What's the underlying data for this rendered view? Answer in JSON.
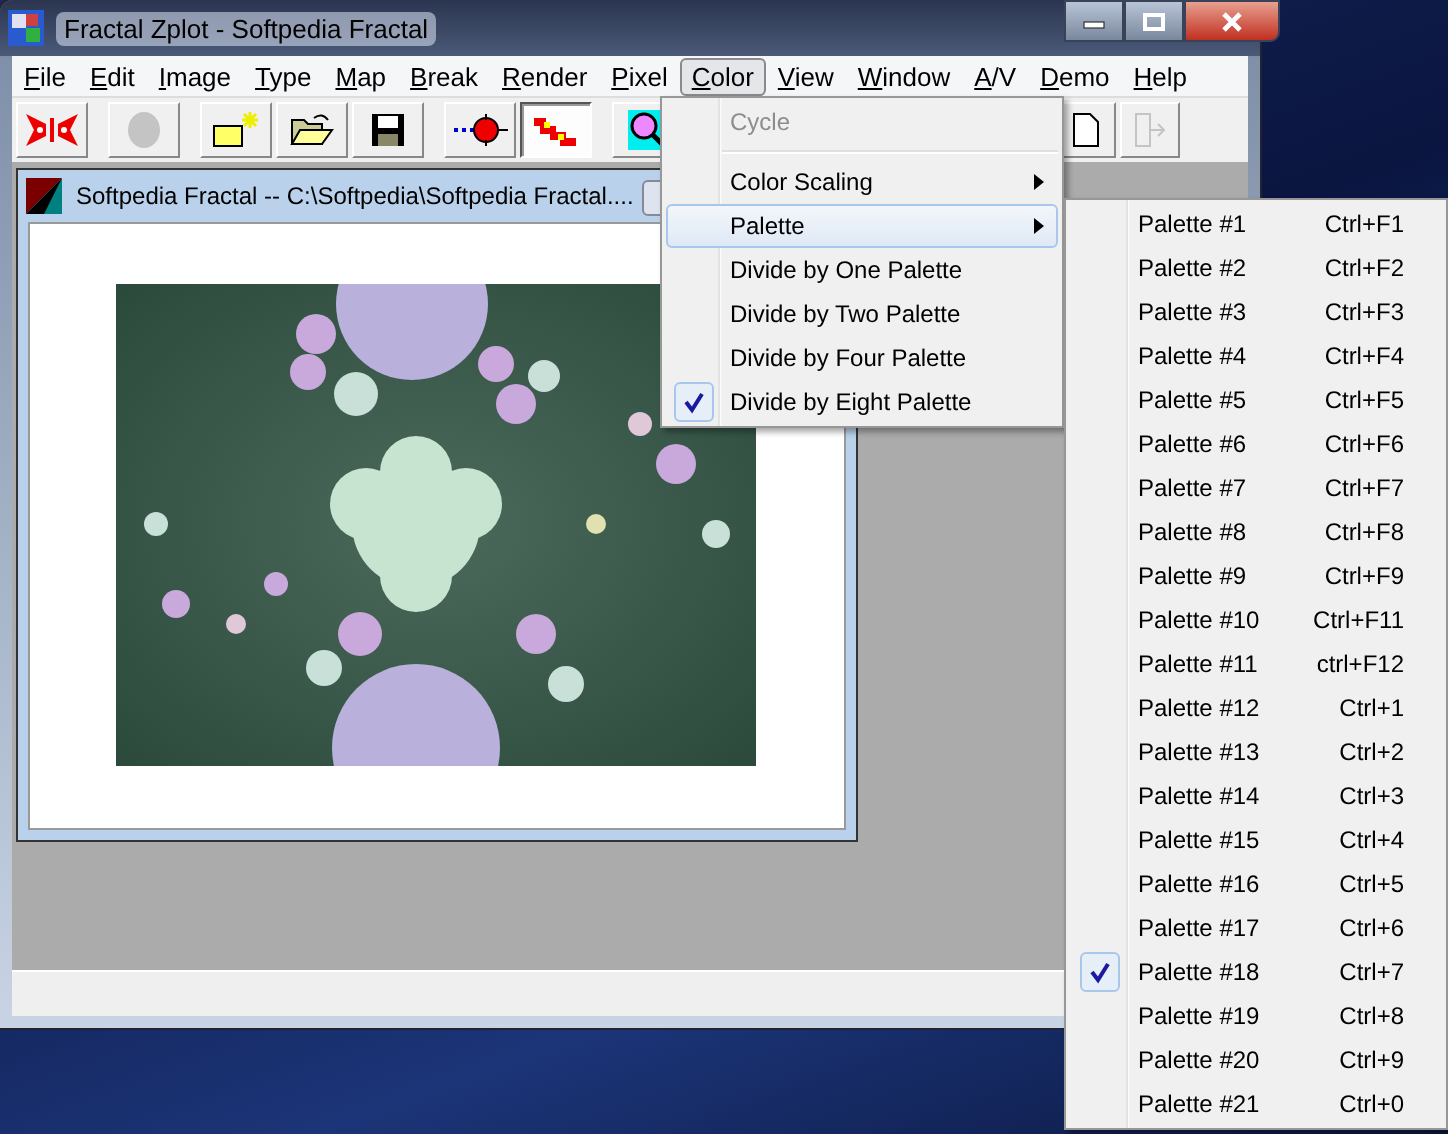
{
  "window": {
    "title": "Fractal Zplot - Softpedia Fractal"
  },
  "menu_bar": [
    {
      "label": "File",
      "selected": false
    },
    {
      "label": "Edit",
      "selected": false
    },
    {
      "label": "Image",
      "selected": false
    },
    {
      "label": "Type",
      "selected": false
    },
    {
      "label": "Map",
      "selected": false
    },
    {
      "label": "Break",
      "selected": false
    },
    {
      "label": "Render",
      "selected": false
    },
    {
      "label": "Pixel",
      "selected": false
    },
    {
      "label": "Color",
      "selected": true
    },
    {
      "label": "View",
      "selected": false
    },
    {
      "label": "Window",
      "selected": false
    },
    {
      "label": "A/V",
      "selected": false
    },
    {
      "label": "Demo",
      "selected": false
    },
    {
      "label": "Help",
      "selected": false
    }
  ],
  "toolbar": [
    {
      "kind": "butterfly",
      "pressed": false,
      "disabled": false
    },
    {
      "kind": "disc",
      "pressed": false,
      "disabled": true
    },
    {
      "kind": "new-image",
      "pressed": false,
      "disabled": false
    },
    {
      "kind": "open",
      "pressed": false,
      "disabled": false
    },
    {
      "kind": "save",
      "pressed": false,
      "disabled": false
    },
    {
      "kind": "points",
      "pressed": false,
      "disabled": false
    },
    {
      "kind": "render",
      "pressed": true,
      "disabled": false
    },
    {
      "kind": "zoom",
      "pressed": false,
      "disabled": false
    },
    {
      "kind": "page",
      "pressed": false,
      "disabled": false
    },
    {
      "kind": "exit",
      "pressed": false,
      "disabled": true
    }
  ],
  "child_window": {
    "title": "Softpedia Fractal -- C:\\Softpedia\\Softpedia Fractal...."
  },
  "color_menu": [
    {
      "kind": "item",
      "label": "Cycle",
      "disabled": true,
      "checked": false,
      "submenu": false,
      "selected": false
    },
    {
      "kind": "separator"
    },
    {
      "kind": "item",
      "label": "Color Scaling",
      "disabled": false,
      "checked": false,
      "submenu": true,
      "selected": false
    },
    {
      "kind": "item",
      "label": "Palette",
      "disabled": false,
      "checked": false,
      "submenu": true,
      "selected": true
    },
    {
      "kind": "item",
      "label": "Divide by One Palette",
      "disabled": false,
      "checked": false,
      "submenu": false,
      "selected": false
    },
    {
      "kind": "item",
      "label": "Divide by Two Palette",
      "disabled": false,
      "checked": false,
      "submenu": false,
      "selected": false
    },
    {
      "kind": "item",
      "label": "Divide by Four Palette",
      "disabled": false,
      "checked": false,
      "submenu": false,
      "selected": false
    },
    {
      "kind": "item",
      "label": "Divide by Eight Palette",
      "disabled": false,
      "checked": true,
      "submenu": false,
      "selected": false
    }
  ],
  "palette_menu": [
    {
      "label": "Palette #1",
      "shortcut": "Ctrl+F1",
      "checked": false
    },
    {
      "label": "Palette #2",
      "shortcut": "Ctrl+F2",
      "checked": false
    },
    {
      "label": "Palette #3",
      "shortcut": "Ctrl+F3",
      "checked": false
    },
    {
      "label": "Palette #4",
      "shortcut": "Ctrl+F4",
      "checked": false
    },
    {
      "label": "Palette #5",
      "shortcut": "Ctrl+F5",
      "checked": false
    },
    {
      "label": "Palette #6",
      "shortcut": "Ctrl+F6",
      "checked": false
    },
    {
      "label": "Palette #7",
      "shortcut": "Ctrl+F7",
      "checked": false
    },
    {
      "label": "Palette #8",
      "shortcut": "Ctrl+F8",
      "checked": false
    },
    {
      "label": "Palette #9",
      "shortcut": "Ctrl+F9",
      "checked": false
    },
    {
      "label": "Palette #10",
      "shortcut": "Ctrl+F11",
      "checked": false
    },
    {
      "label": "Palette #11",
      "shortcut": "ctrl+F12",
      "checked": false
    },
    {
      "label": "Palette #12",
      "shortcut": "Ctrl+1",
      "checked": false
    },
    {
      "label": "Palette #13",
      "shortcut": "Ctrl+2",
      "checked": false
    },
    {
      "label": "Palette #14",
      "shortcut": "Ctrl+3",
      "checked": false
    },
    {
      "label": "Palette #15",
      "shortcut": "Ctrl+4",
      "checked": false
    },
    {
      "label": "Palette #16",
      "shortcut": "Ctrl+5",
      "checked": false
    },
    {
      "label": "Palette #17",
      "shortcut": "Ctrl+6",
      "checked": false
    },
    {
      "label": "Palette #18",
      "shortcut": "Ctrl+7",
      "checked": true
    },
    {
      "label": "Palette #19",
      "shortcut": "Ctrl+8",
      "checked": false
    },
    {
      "label": "Palette #20",
      "shortcut": "Ctrl+9",
      "checked": false
    },
    {
      "label": "Palette #21",
      "shortcut": "Ctrl+0",
      "checked": false
    }
  ]
}
